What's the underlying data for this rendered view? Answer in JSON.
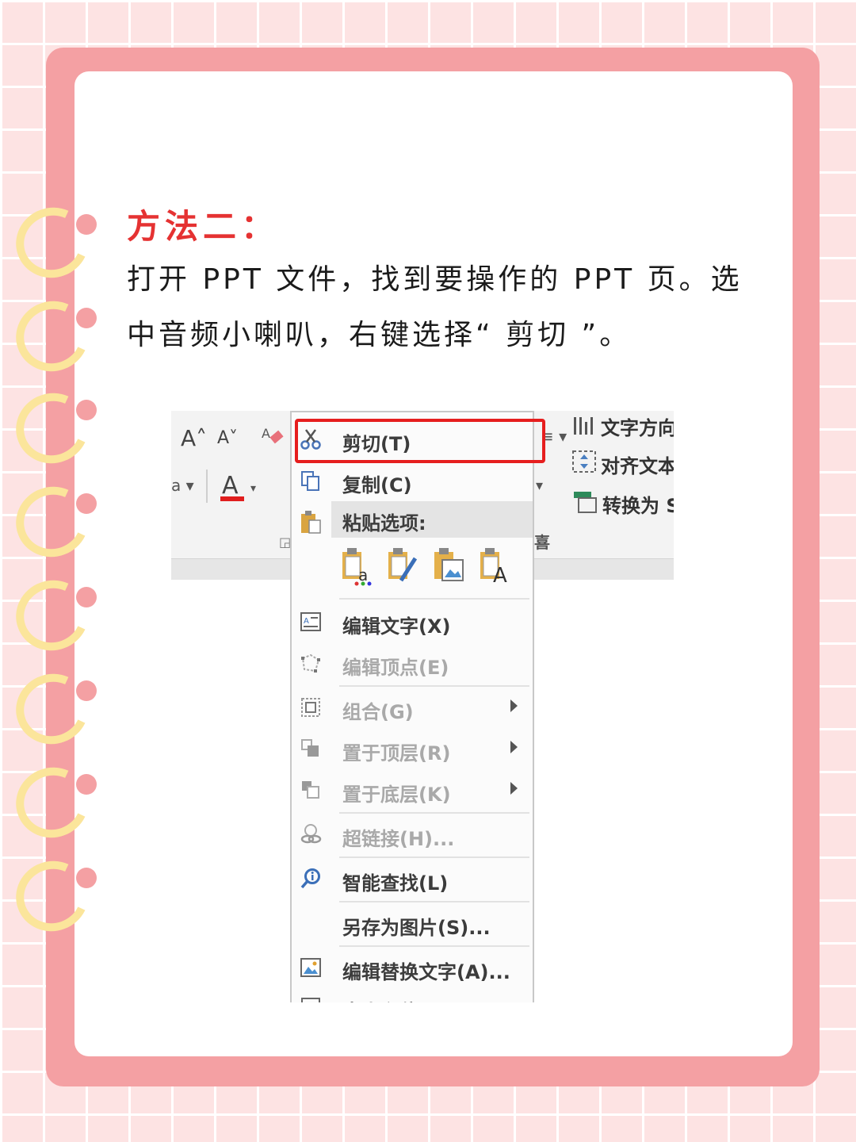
{
  "instruction": {
    "title": "方法二：",
    "body": "打开 PPT 文件，找到要操作的 PPT 页。选中音频小喇叭，右键选择“ 剪切 ”。"
  },
  "ribbon": {
    "text_direction": "文字方向",
    "align_text": "对齐文本",
    "convert_to": "转换为 S"
  },
  "context_menu": {
    "cut": "剪切(T)",
    "copy": "复制(C)",
    "paste_options": "粘贴选项:",
    "edit_text": "编辑文字(X)",
    "edit_points": "编辑顶点(E)",
    "group": "组合(G)",
    "bring_to_front": "置于顶层(R)",
    "send_to_back": "置于底层(K)",
    "hyperlink": "超链接(H)...",
    "smart_lookup": "智能查找(L)",
    "save_as_picture": "另存为图片(S)...",
    "edit_alt_text": "编辑替换文字(A)...",
    "size_position": "大小和位置(Z)..."
  },
  "colors": {
    "highlight": "#e61e1e",
    "title": "#e53232",
    "frame": "#f4a0a3"
  }
}
